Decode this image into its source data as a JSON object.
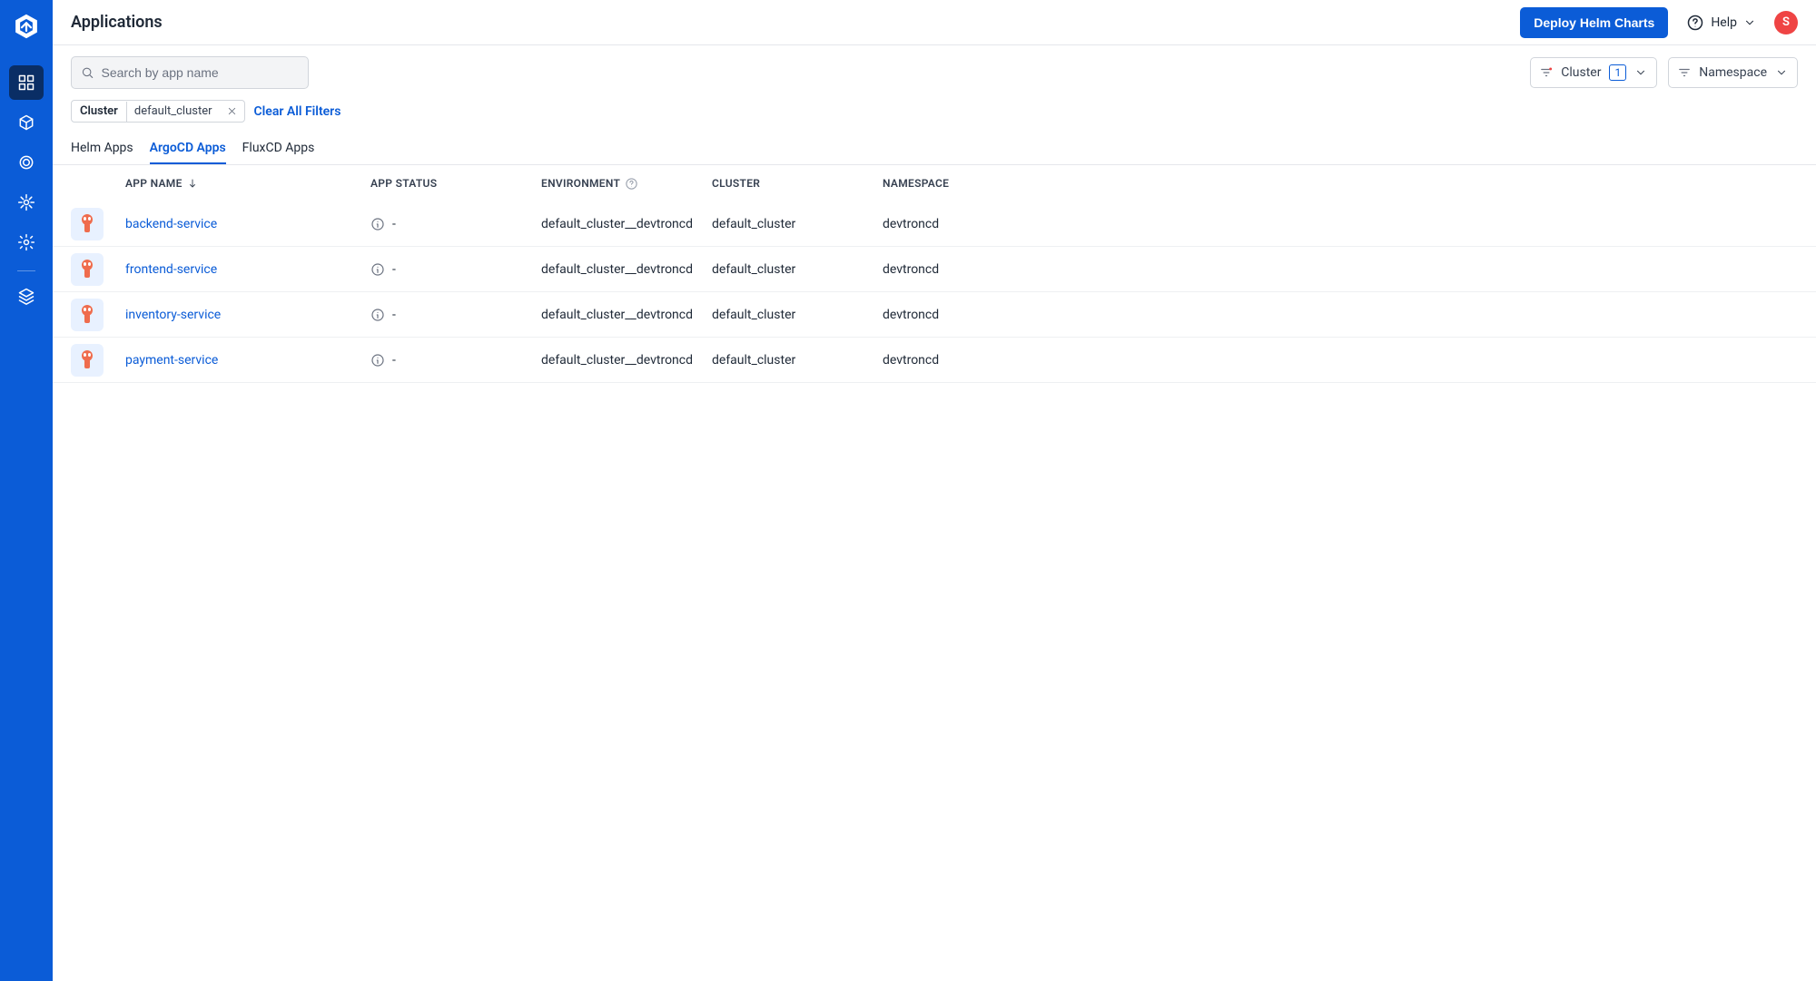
{
  "header": {
    "title": "Applications",
    "deploy_button": "Deploy Helm Charts",
    "help_label": "Help",
    "avatar_initial": "S"
  },
  "search": {
    "placeholder": "Search by app name"
  },
  "filters": {
    "cluster_label": "Cluster",
    "cluster_count": "1",
    "namespace_label": "Namespace"
  },
  "chips": {
    "key": "Cluster",
    "value": "default_cluster",
    "clear_label": "Clear All Filters"
  },
  "tabs": [
    {
      "label": "Helm Apps"
    },
    {
      "label": "ArgoCD Apps"
    },
    {
      "label": "FluxCD Apps"
    }
  ],
  "columns": {
    "app_name": "APP NAME",
    "app_status": "APP STATUS",
    "environment": "ENVIRONMENT",
    "cluster": "CLUSTER",
    "namespace": "NAMESPACE"
  },
  "rows": [
    {
      "name": "backend-service",
      "status": "-",
      "environment": "default_cluster__devtroncd",
      "cluster": "default_cluster",
      "namespace": "devtroncd"
    },
    {
      "name": "frontend-service",
      "status": "-",
      "environment": "default_cluster__devtroncd",
      "cluster": "default_cluster",
      "namespace": "devtroncd"
    },
    {
      "name": "inventory-service",
      "status": "-",
      "environment": "default_cluster__devtroncd",
      "cluster": "default_cluster",
      "namespace": "devtroncd"
    },
    {
      "name": "payment-service",
      "status": "-",
      "environment": "default_cluster__devtroncd",
      "cluster": "default_cluster",
      "namespace": "devtroncd"
    }
  ]
}
